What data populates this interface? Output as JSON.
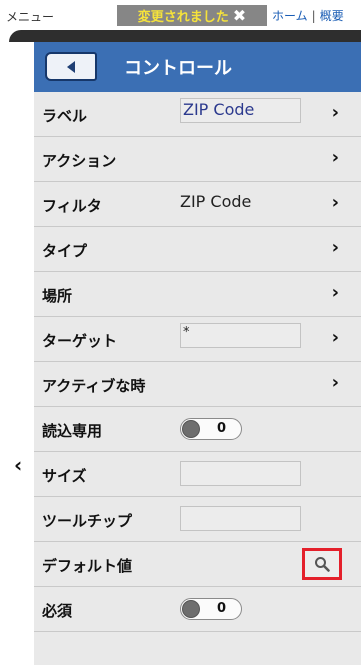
{
  "topbar": {
    "menu": "メニュー",
    "changed_badge": "変更されました",
    "home": "ホーム",
    "separator": "|",
    "overview": "概要"
  },
  "panel": {
    "title": "コントロール",
    "header_color": "#3b6fb4"
  },
  "rows": [
    {
      "label": "ラベル",
      "value": "ZIP Code",
      "chevron": "›"
    },
    {
      "label": "アクション",
      "chevron": "›"
    },
    {
      "label": "フィルタ",
      "value": "ZIP Code",
      "chevron": "›"
    },
    {
      "label": "タイプ",
      "chevron": "›"
    },
    {
      "label": "場所",
      "chevron": "›"
    },
    {
      "label": "ターゲット",
      "value": "*",
      "chevron": "›"
    },
    {
      "label": "アクティブな時",
      "chevron": "›"
    },
    {
      "label": "読込専用",
      "toggle": "0"
    },
    {
      "label": "サイズ",
      "value": ""
    },
    {
      "label": "ツールチップ",
      "value": ""
    },
    {
      "label": "デフォルト値",
      "icon": "search-icon"
    },
    {
      "label": "必須",
      "toggle": "0"
    }
  ],
  "rail": {
    "collapse_arrow": "‹"
  },
  "highlight_color": "#e4202b"
}
